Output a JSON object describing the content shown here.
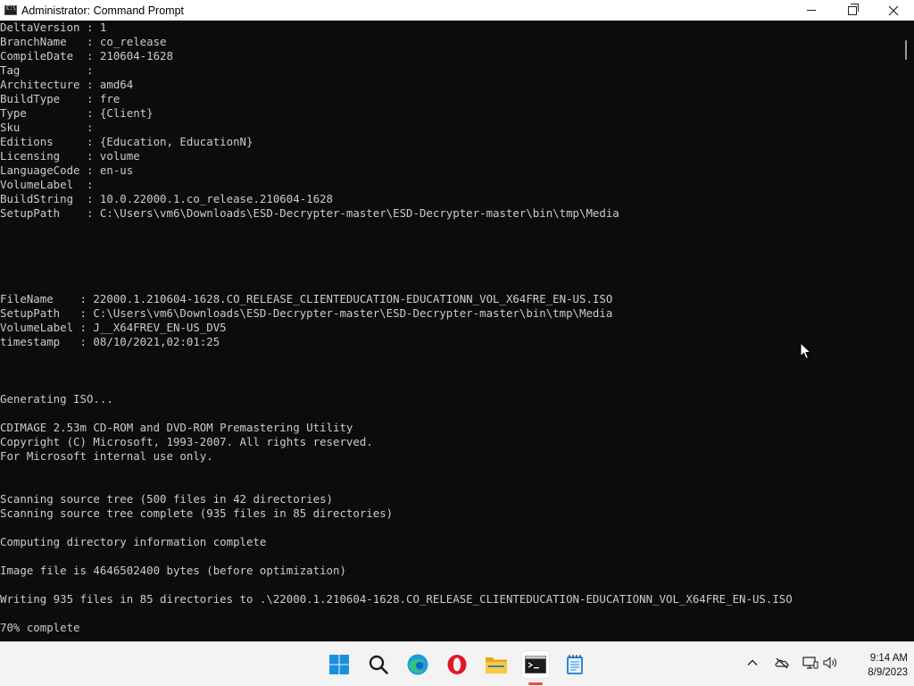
{
  "window": {
    "title": "Administrator: Command Prompt",
    "buttons": {
      "minimize": "—",
      "maximize": "□",
      "close": "✕"
    }
  },
  "console": {
    "lines": [
      "DeltaVersion : 1",
      "BranchName   : co_release",
      "CompileDate  : 210604-1628",
      "Tag          :",
      "Architecture : amd64",
      "BuildType    : fre",
      "Type         : {Client}",
      "Sku          :",
      "Editions     : {Education, EducationN}",
      "Licensing    : volume",
      "LanguageCode : en-us",
      "VolumeLabel  :",
      "BuildString  : 10.0.22000.1.co_release.210604-1628",
      "SetupPath    : C:\\Users\\vm6\\Downloads\\ESD-Decrypter-master\\ESD-Decrypter-master\\bin\\tmp\\Media",
      "",
      "",
      "",
      "",
      "",
      "FileName    : 22000.1.210604-1628.CO_RELEASE_CLIENTEDUCATION-EDUCATIONN_VOL_X64FRE_EN-US.ISO",
      "SetupPath   : C:\\Users\\vm6\\Downloads\\ESD-Decrypter-master\\ESD-Decrypter-master\\bin\\tmp\\Media",
      "VolumeLabel : J__X64FREV_EN-US_DV5",
      "timestamp   : 08/10/2021,02:01:25",
      "",
      "",
      "",
      "Generating ISO...",
      "",
      "CDIMAGE 2.53m CD-ROM and DVD-ROM Premastering Utility",
      "Copyright (C) Microsoft, 1993-2007. All rights reserved.",
      "For Microsoft internal use only.",
      "",
      "",
      "Scanning source tree (500 files in 42 directories)",
      "Scanning source tree complete (935 files in 85 directories)",
      "",
      "Computing directory information complete",
      "",
      "Image file is 4646502400 bytes (before optimization)",
      "",
      "Writing 935 files in 85 directories to .\\22000.1.210604-1628.CO_RELEASE_CLIENTEDUCATION-EDUCATIONN_VOL_X64FRE_EN-US.ISO",
      "",
      "70% complete"
    ]
  },
  "taskbar": {
    "apps": [
      {
        "name": "start-icon"
      },
      {
        "name": "search-icon"
      },
      {
        "name": "edge-icon"
      },
      {
        "name": "opera-icon"
      },
      {
        "name": "file-explorer-icon"
      },
      {
        "name": "command-prompt-icon"
      },
      {
        "name": "notepad-icon"
      }
    ],
    "tray": {
      "chevron": "^",
      "time": "9:14 AM",
      "date": "8/9/2023"
    }
  },
  "colors": {
    "console_bg": "#0c0c0c",
    "console_text": "#cccccc",
    "taskbar_bg": "#f3f3f3",
    "active_indicator": "#e0533c"
  }
}
